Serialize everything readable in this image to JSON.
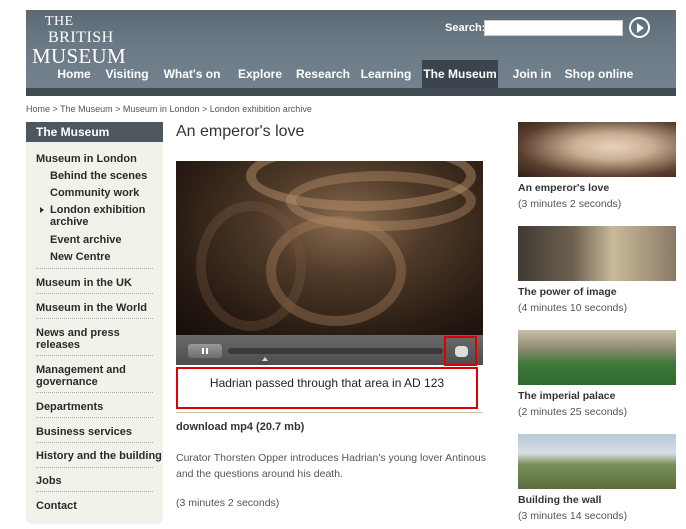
{
  "header": {
    "logo": {
      "line1": "THE",
      "line2": "BRITISH",
      "line3": "MUSEUM"
    },
    "search": {
      "label": "Search:",
      "value": ""
    },
    "nav": [
      "Home",
      "Visiting",
      "What's on",
      "Explore",
      "Research",
      "Learning",
      "The Museum",
      "Join in",
      "Shop online"
    ],
    "active_nav": "The Museum"
  },
  "breadcrumb": [
    "Home",
    "The Museum",
    "Museum in London",
    "London exhibition archive"
  ],
  "breadcrumb_sep": " > ",
  "sidebar": {
    "title": "The Museum",
    "items": [
      {
        "label": "Museum in London"
      },
      {
        "label": "Behind the scenes"
      },
      {
        "label": "Community work"
      },
      {
        "label": "London exhibition archive",
        "current": true
      },
      {
        "label": "Event archive"
      },
      {
        "label": "New Centre"
      },
      {
        "label": "Museum in the UK"
      },
      {
        "label": "Museum in the World"
      },
      {
        "label": "News and press releases"
      },
      {
        "label": "Management and governance"
      },
      {
        "label": "Departments"
      },
      {
        "label": "Business services"
      },
      {
        "label": "History and the building"
      },
      {
        "label": "Jobs"
      },
      {
        "label": "Contact"
      }
    ]
  },
  "main": {
    "title": "An emperor's love",
    "caption": "Hadrian passed through that area in AD 123",
    "download": "download mp4 (20.7 mb)",
    "description": "Curator Thorsten Opper introduces Hadrian's young lover Antinous and the questions around his death.",
    "duration": "(3 minutes 2 seconds)"
  },
  "related": [
    {
      "title": "An emperor's love",
      "duration": "(3 minutes 2 seconds)"
    },
    {
      "title": "The power of image",
      "duration": "(4 minutes 10 seconds)"
    },
    {
      "title": "The imperial palace",
      "duration": "(2 minutes 25 seconds)"
    },
    {
      "title": "Building the wall",
      "duration": "(3 minutes 14 seconds)"
    }
  ]
}
